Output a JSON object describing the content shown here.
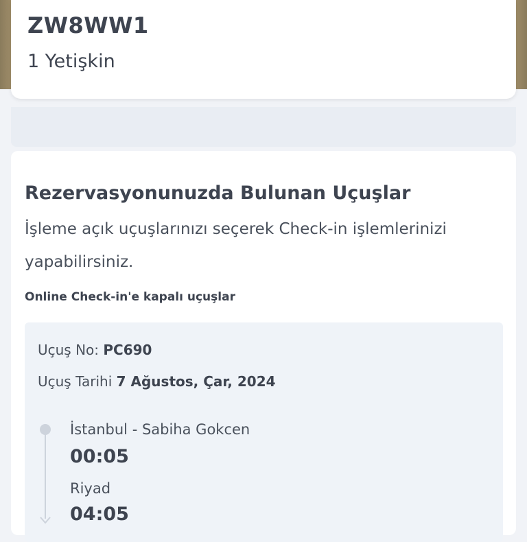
{
  "booking": {
    "pnr": "ZW8WW1",
    "passengers": "1 Yetişkin"
  },
  "flights_section": {
    "title": "Rezervasyonunuzda Bulunan Uçuşlar",
    "description": "İşleme açık uçuşlarınızı seçerek Check-in işlemlerinizi yapabilirsiniz.",
    "closed_label": "Online Check-in'e kapalı uçuşlar"
  },
  "flight": {
    "no_label": "Uçuş No:",
    "no_value": "PC690",
    "date_label": "Uçuş Tarihi",
    "date_value": "7 Ağustos, Çar, 2024",
    "departure_city": "İstanbul - Sabiha Gokcen",
    "departure_time": "00:05",
    "arrival_city": "Riyad",
    "arrival_time": "04:05"
  },
  "icons": {
    "timeline_dot": "circle-dot-icon",
    "timeline_arrow": "arrow-down-icon"
  }
}
